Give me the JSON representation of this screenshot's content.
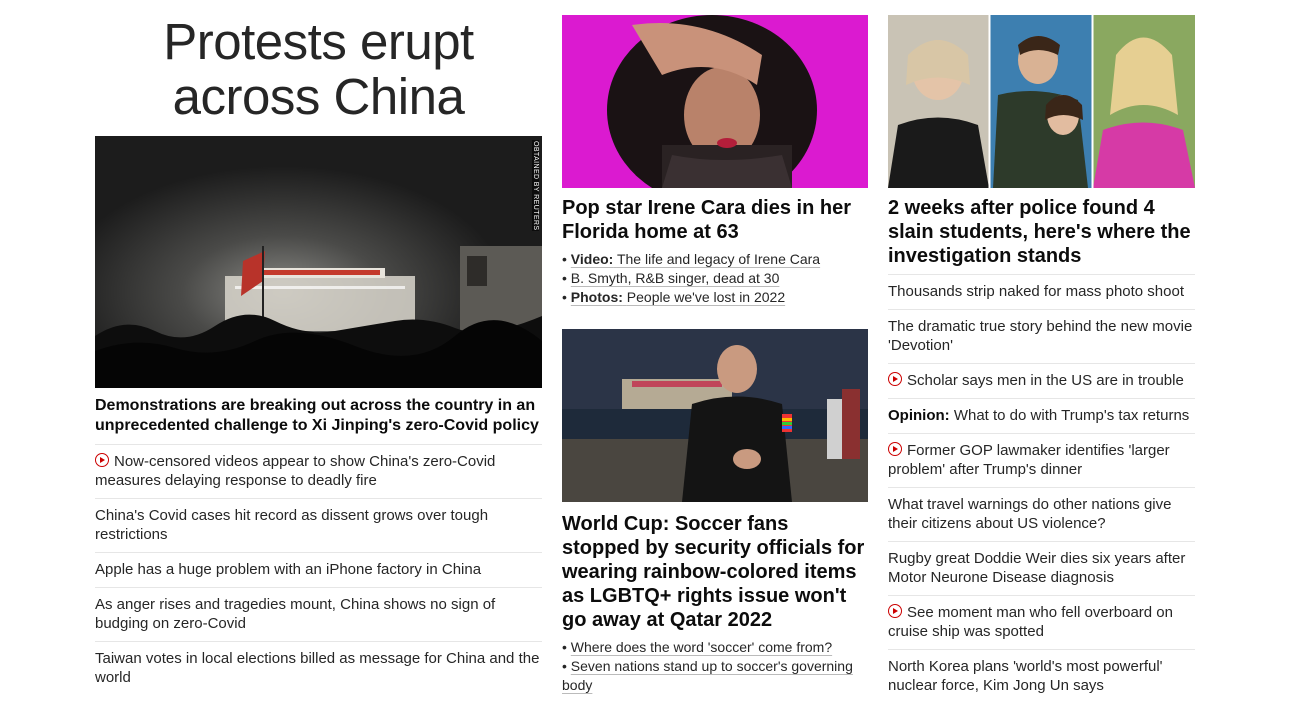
{
  "col1": {
    "title": "Protests erupt across China",
    "image_credit": "OBTAINED BY REUTERS",
    "lead": "Demonstrations are breaking out across the country in an unprecedented challenge to Xi Jinping's zero-Covid policy",
    "links": [
      {
        "text": "Now-censored videos appear to show China's zero-Covid measures delaying response to deadly fire",
        "video": true
      },
      {
        "text": "China's Covid cases hit record as dissent grows over tough restrictions"
      },
      {
        "text": "Apple has a huge problem with an iPhone factory in China"
      },
      {
        "text": "As anger rises and tragedies mount, China shows no sign of budging on zero-Covid"
      },
      {
        "text": "Taiwan votes in local elections billed as message for China and the world"
      }
    ]
  },
  "col2": {
    "story1": {
      "headline": "Pop star Irene Cara dies in her Florida home at 63",
      "sublinks": [
        {
          "prefix": "Video:",
          "text": "The life and legacy of Irene Cara"
        },
        {
          "prefix": "",
          "text": "B. Smyth, R&B singer, dead at 30"
        },
        {
          "prefix": "Photos:",
          "text": "People we've lost in 2022"
        }
      ]
    },
    "story2": {
      "headline": "World Cup: Soccer fans stopped by security officials for wearing rainbow-colored items as LGBTQ+ rights issue won't go away at Qatar 2022",
      "sublinks": [
        {
          "text": "Where does the word 'soccer' come from?"
        },
        {
          "text": "Seven nations stand up to soccer's governing body"
        }
      ]
    }
  },
  "col3": {
    "headline": "2 weeks after police found 4 slain students, here's where the investigation stands",
    "links": [
      {
        "text": "Thousands strip naked for mass photo shoot"
      },
      {
        "text": "The dramatic true story behind the new movie 'Devotion'"
      },
      {
        "text": "Scholar says men in the US are in trouble",
        "video": true
      },
      {
        "prefix": "Opinion:",
        "text": "What to do with Trump's tax returns"
      },
      {
        "text": "Former GOP lawmaker identifies 'larger problem' after Trump's dinner",
        "video": true
      },
      {
        "text": "What travel warnings do other nations give their citizens about US violence?"
      },
      {
        "text": "Rugby great Doddie Weir dies six years after Motor Neurone Disease diagnosis"
      },
      {
        "text": "See moment man who fell overboard on cruise ship was spotted",
        "video": true
      },
      {
        "text": "North Korea plans 'world's most powerful' nuclear force, Kim Jong Un says"
      }
    ]
  },
  "colors": {
    "accent_red": "#cc0000",
    "divider": "#e6e6e6",
    "text": "#0c0c0c"
  }
}
